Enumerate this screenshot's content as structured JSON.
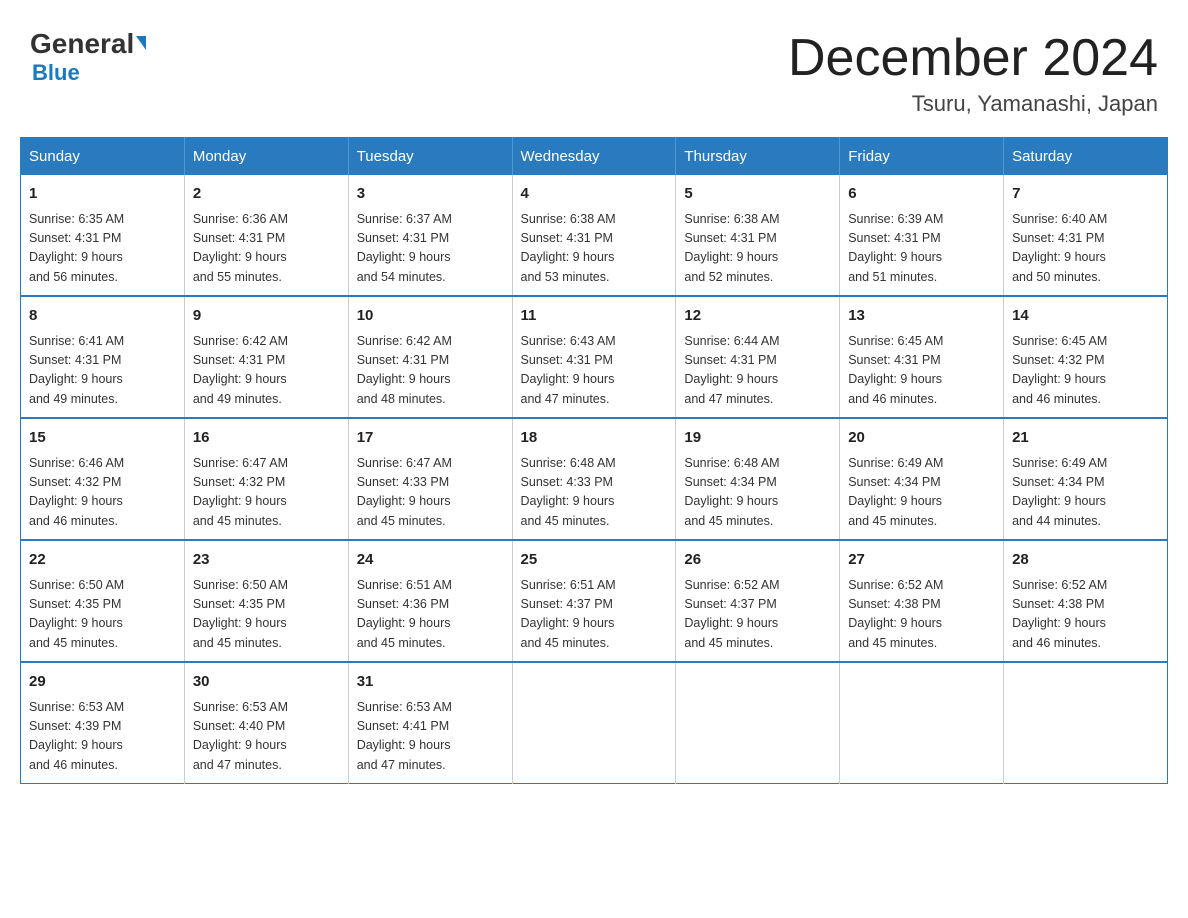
{
  "header": {
    "logo_general": "General",
    "logo_blue": "Blue",
    "title": "December 2024",
    "subtitle": "Tsuru, Yamanashi, Japan"
  },
  "columns": [
    "Sunday",
    "Monday",
    "Tuesday",
    "Wednesday",
    "Thursday",
    "Friday",
    "Saturday"
  ],
  "weeks": [
    [
      {
        "day": "1",
        "sunrise": "6:35 AM",
        "sunset": "4:31 PM",
        "daylight": "9 hours and 56 minutes."
      },
      {
        "day": "2",
        "sunrise": "6:36 AM",
        "sunset": "4:31 PM",
        "daylight": "9 hours and 55 minutes."
      },
      {
        "day": "3",
        "sunrise": "6:37 AM",
        "sunset": "4:31 PM",
        "daylight": "9 hours and 54 minutes."
      },
      {
        "day": "4",
        "sunrise": "6:38 AM",
        "sunset": "4:31 PM",
        "daylight": "9 hours and 53 minutes."
      },
      {
        "day": "5",
        "sunrise": "6:38 AM",
        "sunset": "4:31 PM",
        "daylight": "9 hours and 52 minutes."
      },
      {
        "day": "6",
        "sunrise": "6:39 AM",
        "sunset": "4:31 PM",
        "daylight": "9 hours and 51 minutes."
      },
      {
        "day": "7",
        "sunrise": "6:40 AM",
        "sunset": "4:31 PM",
        "daylight": "9 hours and 50 minutes."
      }
    ],
    [
      {
        "day": "8",
        "sunrise": "6:41 AM",
        "sunset": "4:31 PM",
        "daylight": "9 hours and 49 minutes."
      },
      {
        "day": "9",
        "sunrise": "6:42 AM",
        "sunset": "4:31 PM",
        "daylight": "9 hours and 49 minutes."
      },
      {
        "day": "10",
        "sunrise": "6:42 AM",
        "sunset": "4:31 PM",
        "daylight": "9 hours and 48 minutes."
      },
      {
        "day": "11",
        "sunrise": "6:43 AM",
        "sunset": "4:31 PM",
        "daylight": "9 hours and 47 minutes."
      },
      {
        "day": "12",
        "sunrise": "6:44 AM",
        "sunset": "4:31 PM",
        "daylight": "9 hours and 47 minutes."
      },
      {
        "day": "13",
        "sunrise": "6:45 AM",
        "sunset": "4:31 PM",
        "daylight": "9 hours and 46 minutes."
      },
      {
        "day": "14",
        "sunrise": "6:45 AM",
        "sunset": "4:32 PM",
        "daylight": "9 hours and 46 minutes."
      }
    ],
    [
      {
        "day": "15",
        "sunrise": "6:46 AM",
        "sunset": "4:32 PM",
        "daylight": "9 hours and 46 minutes."
      },
      {
        "day": "16",
        "sunrise": "6:47 AM",
        "sunset": "4:32 PM",
        "daylight": "9 hours and 45 minutes."
      },
      {
        "day": "17",
        "sunrise": "6:47 AM",
        "sunset": "4:33 PM",
        "daylight": "9 hours and 45 minutes."
      },
      {
        "day": "18",
        "sunrise": "6:48 AM",
        "sunset": "4:33 PM",
        "daylight": "9 hours and 45 minutes."
      },
      {
        "day": "19",
        "sunrise": "6:48 AM",
        "sunset": "4:34 PM",
        "daylight": "9 hours and 45 minutes."
      },
      {
        "day": "20",
        "sunrise": "6:49 AM",
        "sunset": "4:34 PM",
        "daylight": "9 hours and 45 minutes."
      },
      {
        "day": "21",
        "sunrise": "6:49 AM",
        "sunset": "4:34 PM",
        "daylight": "9 hours and 44 minutes."
      }
    ],
    [
      {
        "day": "22",
        "sunrise": "6:50 AM",
        "sunset": "4:35 PM",
        "daylight": "9 hours and 45 minutes."
      },
      {
        "day": "23",
        "sunrise": "6:50 AM",
        "sunset": "4:35 PM",
        "daylight": "9 hours and 45 minutes."
      },
      {
        "day": "24",
        "sunrise": "6:51 AM",
        "sunset": "4:36 PM",
        "daylight": "9 hours and 45 minutes."
      },
      {
        "day": "25",
        "sunrise": "6:51 AM",
        "sunset": "4:37 PM",
        "daylight": "9 hours and 45 minutes."
      },
      {
        "day": "26",
        "sunrise": "6:52 AM",
        "sunset": "4:37 PM",
        "daylight": "9 hours and 45 minutes."
      },
      {
        "day": "27",
        "sunrise": "6:52 AM",
        "sunset": "4:38 PM",
        "daylight": "9 hours and 45 minutes."
      },
      {
        "day": "28",
        "sunrise": "6:52 AM",
        "sunset": "4:38 PM",
        "daylight": "9 hours and 46 minutes."
      }
    ],
    [
      {
        "day": "29",
        "sunrise": "6:53 AM",
        "sunset": "4:39 PM",
        "daylight": "9 hours and 46 minutes."
      },
      {
        "day": "30",
        "sunrise": "6:53 AM",
        "sunset": "4:40 PM",
        "daylight": "9 hours and 47 minutes."
      },
      {
        "day": "31",
        "sunrise": "6:53 AM",
        "sunset": "4:41 PM",
        "daylight": "9 hours and 47 minutes."
      },
      null,
      null,
      null,
      null
    ]
  ],
  "labels": {
    "sunrise": "Sunrise:",
    "sunset": "Sunset:",
    "daylight": "Daylight:"
  }
}
